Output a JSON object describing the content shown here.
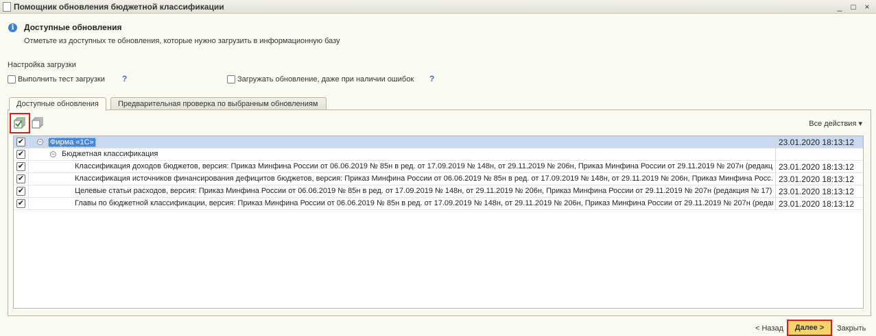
{
  "window": {
    "title": "Помощник обновления бюджетной классификации",
    "minimize": "_",
    "maximize": "□",
    "close": "×"
  },
  "header": {
    "title": "Доступные обновления",
    "subtitle": "Отметьте из доступных те обновления, которые нужно загрузить в информационную базу"
  },
  "settings": {
    "label": "Настройка загрузки",
    "test_load_label": "Выполнить тест загрузки",
    "load_with_errors_label": "Загружать обновление, даже при наличии ошибок",
    "help": "?"
  },
  "tabs": [
    {
      "label": "Доступные обновления"
    },
    {
      "label": "Предварительная проверка по выбранным обновлениям"
    }
  ],
  "toolbar": {
    "all_actions": "Все действия ▾"
  },
  "rows": [
    {
      "checked": true,
      "level": 0,
      "expander": "⊖",
      "name": "Фирма «1С»",
      "date": "23.01.2020 18:13:12"
    },
    {
      "checked": true,
      "level": 1,
      "expander": "⊖",
      "name": "Бюджетная классификация",
      "date": ""
    },
    {
      "checked": true,
      "level": 2,
      "name": "Классификация доходов бюджетов, версия: Приказ Минфина России от 06.06.2019 № 85н в ред. от 17.09.2019 № 148н, от 29.11.2019 № 206н, Приказ Минфина России от 29.11.2019 № 207н (редакци...",
      "date": "23.01.2020 18:13:12"
    },
    {
      "checked": true,
      "level": 2,
      "name": "Классификация источников финансирования дефицитов бюджетов, версия: Приказ Минфина России от 06.06.2019 № 85н в ред. от 17.09.2019 № 148н, от 29.11.2019 № 206н, Приказ Минфина Росс...",
      "date": "23.01.2020 18:13:12"
    },
    {
      "checked": true,
      "level": 2,
      "name": "Целевые статьи расходов, версия: Приказ Минфина России от 06.06.2019 № 85н в ред. от 17.09.2019 № 148н, от 29.11.2019 № 206н, Приказ Минфина России от 29.11.2019 № 207н (редакция № 17)",
      "date": "23.01.2020 18:13:12"
    },
    {
      "checked": true,
      "level": 2,
      "name": "Главы по бюджетной классификации, версия: Приказ Минфина России от 06.06.2019 № 85н в ред. от 17.09.2019 № 148н, от 29.11.2019 № 206н, Приказ Минфина России от 29.11.2019 № 207н (редак...",
      "date": "23.01.2020 18:13:12"
    }
  ],
  "footer": {
    "back": "< Назад",
    "next": "Далее >",
    "close": "Закрыть"
  }
}
